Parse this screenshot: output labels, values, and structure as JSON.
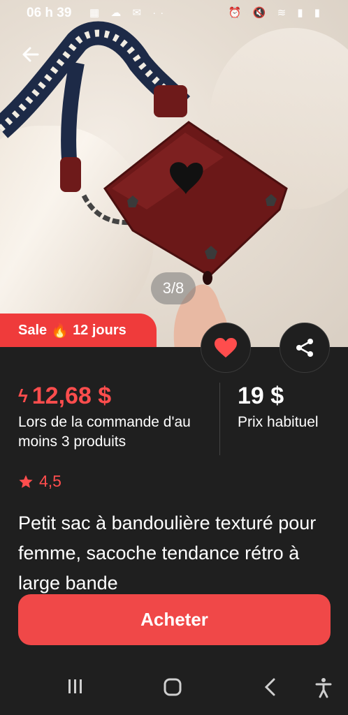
{
  "status_bar": {
    "time": "06 h 39"
  },
  "gallery": {
    "counter": "3/8"
  },
  "sale_badge": {
    "label": "Sale",
    "emoji": "🔥",
    "duration": "12 jours"
  },
  "pricing": {
    "sale_price": "12,68 $",
    "sale_note": "Lors de la commande d'au moins 3 produits",
    "regular_price": "19 $",
    "regular_note": "Prix habituel"
  },
  "rating": {
    "value": "4,5"
  },
  "product": {
    "title": "Petit sac à bandoulière texturé pour femme, sacoche tendance rétro à large bande"
  },
  "actions": {
    "buy_label": "Acheter"
  },
  "colors": {
    "accent": "#f04848",
    "background": "#1f1f1f",
    "sale_text": "#ff4d4d"
  },
  "icons": {
    "back": "arrow-left-icon",
    "favorite": "heart-icon",
    "share": "share-icon",
    "recent": "recent-apps-icon",
    "home": "home-icon",
    "nav_back": "chevron-left-icon",
    "accessibility": "accessibility-icon"
  }
}
